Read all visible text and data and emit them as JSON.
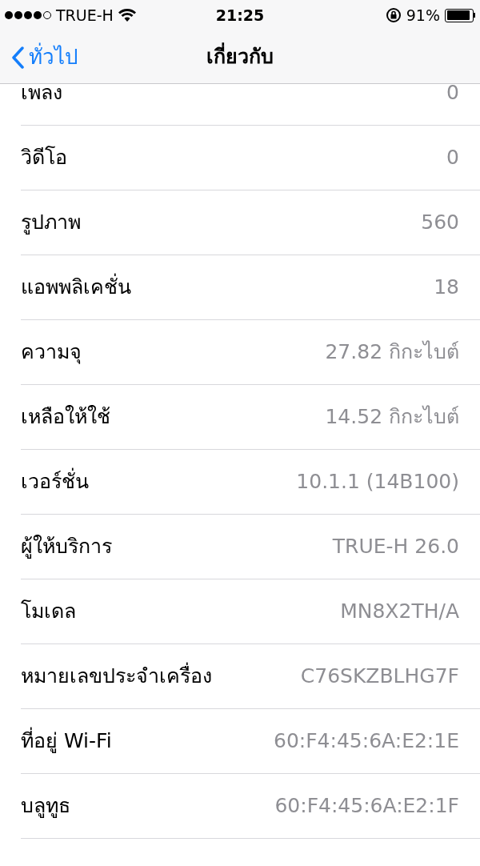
{
  "status_bar": {
    "carrier": "TRUE-H",
    "time": "21:25",
    "battery_percent": "91%"
  },
  "nav": {
    "back": "ทั่วไป",
    "title": "เกี่ยวกับ"
  },
  "rows": [
    {
      "label": "เพลง",
      "value": "0"
    },
    {
      "label": "วิดีโอ",
      "value": "0"
    },
    {
      "label": "รูปภาพ",
      "value": "560"
    },
    {
      "label": "แอพพลิเคชั่น",
      "value": "18"
    },
    {
      "label": "ความจุ",
      "value": "27.82 กิกะไบต์"
    },
    {
      "label": "เหลือให้ใช้",
      "value": "14.52 กิกะไบต์"
    },
    {
      "label": "เวอร์ชั่น",
      "value": "10.1.1 (14B100)"
    },
    {
      "label": "ผู้ให้บริการ",
      "value": "TRUE-H 26.0"
    },
    {
      "label": "โมเดล",
      "value": "MN8X2TH/A"
    },
    {
      "label": "หมายเลขประจำเครื่อง",
      "value": "C76SKZBLHG7F"
    },
    {
      "label": "ที่อยู่ Wi-Fi",
      "value": "60:F4:45:6A:E2:1E"
    },
    {
      "label": "บลูทูธ",
      "value": "60:F4:45:6A:E2:1F"
    }
  ]
}
